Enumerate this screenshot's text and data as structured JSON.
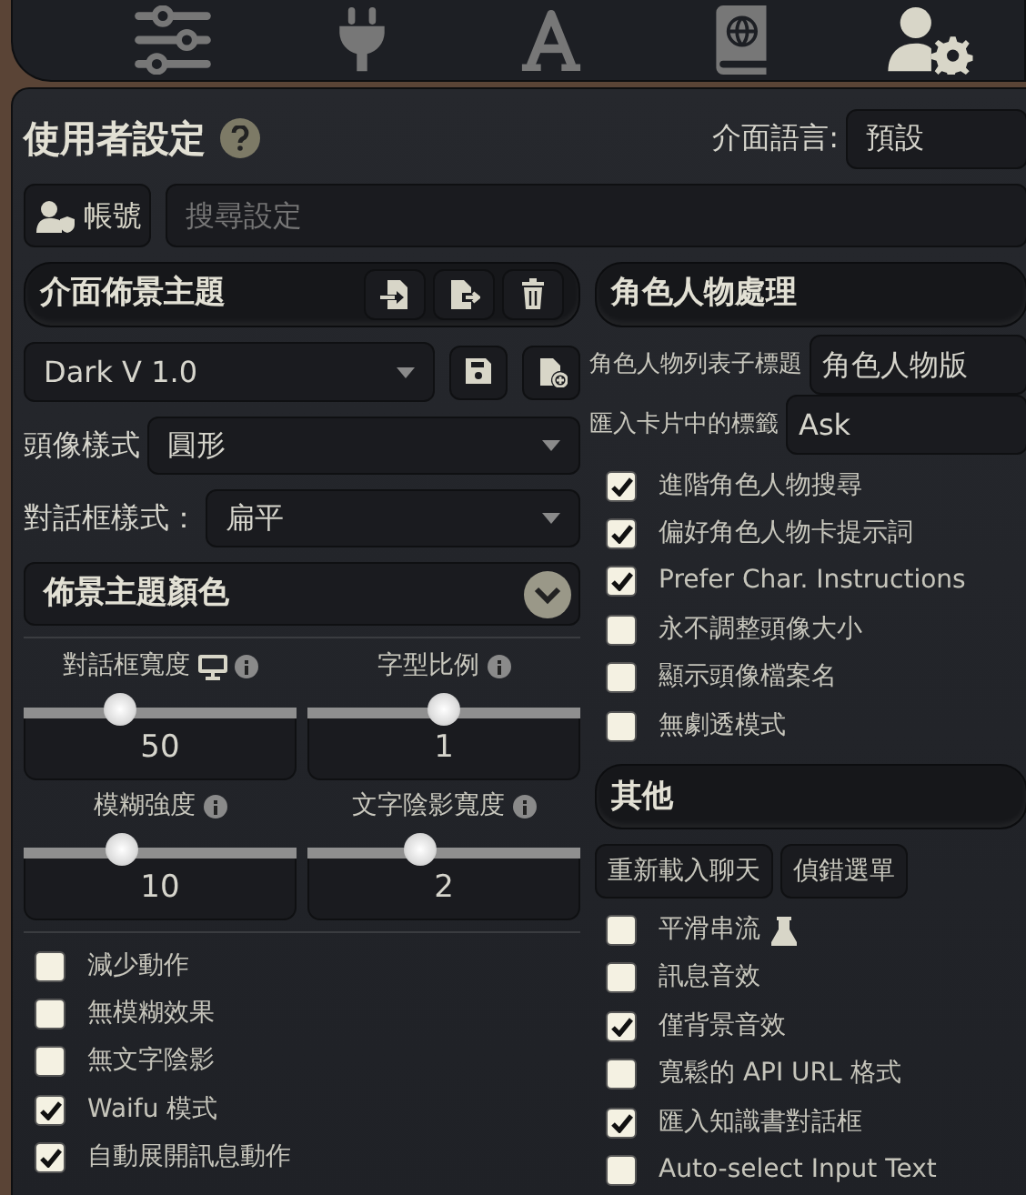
{
  "nav_tabs": [
    {
      "selected": false
    },
    {
      "selected": false
    },
    {
      "selected": false
    },
    {
      "selected": false
    },
    {
      "selected": true
    }
  ],
  "header": {
    "title": "使用者設定",
    "language_label": "介面語言:",
    "language_value": "預設"
  },
  "account_button": "帳號",
  "search": {
    "placeholder": "搜尋設定"
  },
  "theme": {
    "title": "介面佈景主題",
    "preset": "Dark V 1.0",
    "avatar_style_label": "頭像樣式",
    "avatar_style": "圓形",
    "chat_style_label": "對話框樣式：",
    "chat_style": "扁平",
    "colors_title": "佈景主題顏色",
    "colors_expanded": false
  },
  "sliders": [
    {
      "label": "對話框寬度",
      "kind": "desktop",
      "level": 0.35,
      "value": "50"
    },
    {
      "label": "字型比例",
      "kind": "plain",
      "level": 0.5,
      "value": "1"
    },
    {
      "label": "模糊強度",
      "kind": "plain",
      "level": 0.36,
      "value": "10"
    },
    {
      "label": "文字陰影寬度",
      "kind": "plain",
      "level": 0.41,
      "value": "2"
    }
  ],
  "left_checkboxes": [
    {
      "label": "減少動作",
      "checked": false
    },
    {
      "label": "無模糊效果",
      "checked": false
    },
    {
      "label": "無文字陰影",
      "checked": false
    },
    {
      "label": "Waifu 模式",
      "checked": true
    },
    {
      "label": "自動展開訊息動作",
      "checked": true
    }
  ],
  "character_handling": {
    "title": "角色人物處理",
    "fields": [
      {
        "label": "角色人物列表子標題",
        "value": "角色人物版"
      },
      {
        "label": "匯入卡片中的標籤",
        "value": "Ask"
      }
    ],
    "checkboxes": [
      {
        "label": "進階角色人物搜尋",
        "checked": true
      },
      {
        "label": "偏好角色人物卡提示詞",
        "checked": true
      },
      {
        "label": "Prefer Char. Instructions",
        "checked": true
      },
      {
        "label": "永不調整頭像大小",
        "checked": false
      },
      {
        "label": "顯示頭像檔案名",
        "checked": false
      },
      {
        "label": "無劇透模式",
        "checked": false
      }
    ]
  },
  "misc": {
    "title": "其他",
    "buttons": [
      "重新載入聊天",
      "偵錯選單"
    ],
    "checkboxes": [
      {
        "label": "平滑串流",
        "checked": false,
        "kind": "experimental"
      },
      {
        "label": "訊息音效",
        "checked": false,
        "kind": "plain"
      },
      {
        "label": "僅背景音效",
        "checked": true,
        "kind": "plain"
      },
      {
        "label": "寬鬆的 API URL 格式",
        "checked": false,
        "kind": "plain"
      },
      {
        "label": "匯入知識書對話框",
        "checked": true,
        "kind": "plain"
      },
      {
        "label": "Auto-select Input Text",
        "checked": false,
        "kind": "plain"
      }
    ]
  }
}
